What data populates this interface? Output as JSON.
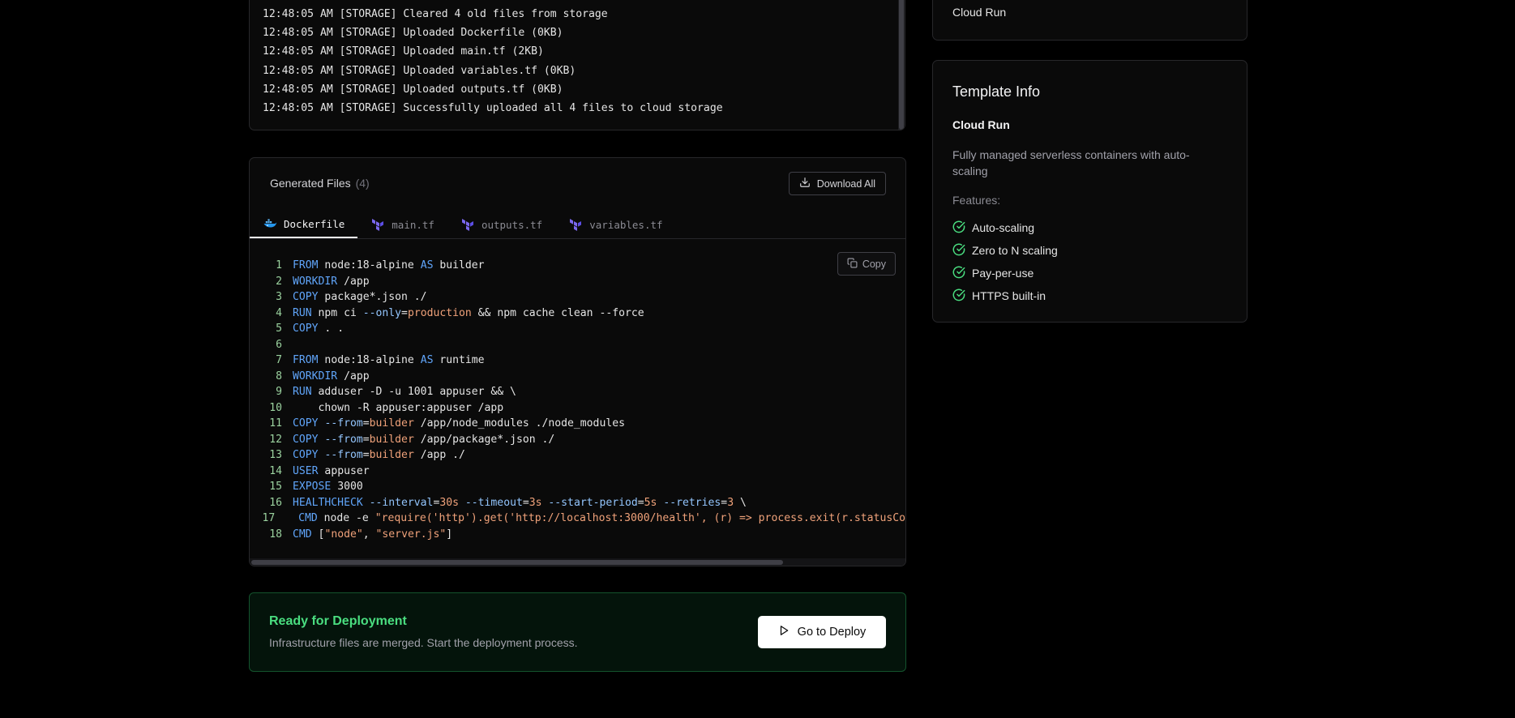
{
  "logs": {
    "lines": [
      "12:48:05 AM [STORAGE] Cleared 4 old files from storage",
      "12:48:05 AM [STORAGE] Uploaded Dockerfile (0KB)",
      "12:48:05 AM [STORAGE] Uploaded main.tf (2KB)",
      "12:48:05 AM [STORAGE] Uploaded variables.tf (0KB)",
      "12:48:05 AM [STORAGE] Uploaded outputs.tf (0KB)",
      "12:48:05 AM [STORAGE] Successfully uploaded all 4 files to cloud storage"
    ]
  },
  "files": {
    "title": "Generated Files",
    "count": "(4)",
    "download_label": "Download All",
    "copy_label": "Copy",
    "tabs": [
      {
        "label": "Dockerfile",
        "icon": "docker-icon",
        "active": true
      },
      {
        "label": "main.tf",
        "icon": "terraform-icon",
        "active": false
      },
      {
        "label": "outputs.tf",
        "icon": "terraform-icon",
        "active": false
      },
      {
        "label": "variables.tf",
        "icon": "terraform-icon",
        "active": false
      }
    ],
    "code_lines": [
      "FROM node:18-alpine AS builder",
      "WORKDIR /app",
      "COPY package*.json ./",
      "RUN npm ci --only=production && npm cache clean --force",
      "COPY . .",
      "",
      "FROM node:18-alpine AS runtime",
      "WORKDIR /app",
      "RUN adduser -D -u 1001 appuser && \\",
      "    chown -R appuser:appuser /app",
      "COPY --from=builder /app/node_modules ./node_modules",
      "COPY --from=builder /app/package*.json ./",
      "COPY --from=builder /app ./",
      "USER appuser",
      "EXPOSE 3000",
      "HEALTHCHECK --interval=30s --timeout=3s --start-period=5s --retries=3 \\",
      "  CMD node -e \"require('http').get('http://localhost:3000/health', (r) => process.exit(r.statusCo",
      "CMD [\"node\", \"server.js\"]"
    ]
  },
  "deploy": {
    "title": "Ready for Deployment",
    "description": "Infrastructure files are merged. Start the deployment process.",
    "button_label": "Go to Deploy"
  },
  "sidebar": {
    "top_card_text": "Cloud Run",
    "template_info": {
      "title": "Template Info",
      "name": "Cloud Run",
      "description": "Fully managed serverless containers with auto-scaling",
      "features_label": "Features:",
      "features": [
        "Auto-scaling",
        "Zero to N scaling",
        "Pay-per-use",
        "HTTPS built-in"
      ]
    }
  },
  "colors": {
    "accent_green": "#4ade80",
    "keyword_blue": "#60a5fa",
    "string_orange": "#f0a27a",
    "terraform_purple": "#7b68ee",
    "docker_blue": "#2496ed"
  }
}
